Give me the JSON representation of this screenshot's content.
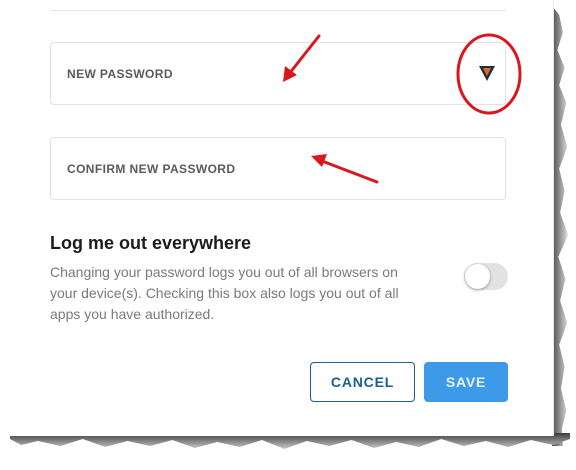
{
  "form": {
    "new_password_label": "NEW PASSWORD",
    "confirm_password_label": "CONFIRM NEW PASSWORD",
    "password_manager_icon": "password-manager-icon"
  },
  "logout_section": {
    "title": "Log me out everywhere",
    "description": "Changing your password logs you out of all browsers on your device(s). Checking this box also logs you out of all apps you have authorized.",
    "toggle_on": false
  },
  "actions": {
    "cancel_label": "CANCEL",
    "save_label": "SAVE"
  },
  "colors": {
    "primary": "#1a5f8f",
    "save_button": "#3d9ae8",
    "annotation": "#d9171f"
  }
}
